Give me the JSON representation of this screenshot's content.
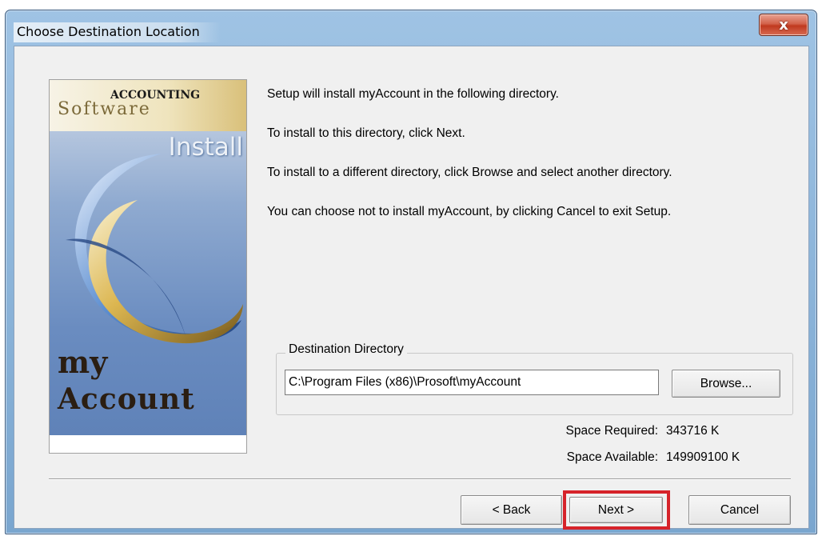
{
  "window": {
    "title": "Choose Destination Location",
    "close_label": "x"
  },
  "banner": {
    "accounting": "ACCOUNTING",
    "software": "Software",
    "install": "Install",
    "my": "my",
    "account": "Account"
  },
  "info": {
    "line1": "Setup will install myAccount in the following directory.",
    "line2": "To install to this directory, click Next.",
    "line3": "To install to a different directory, click Browse and select another directory.",
    "line4": "You can choose not to install myAccount, by clicking Cancel to exit Setup."
  },
  "destination": {
    "legend": "Destination Directory",
    "path": "C:\\Program Files (x86)\\Prosoft\\myAccount",
    "browse_label": "Browse..."
  },
  "space": {
    "required_label": "Space Required:",
    "required_value": "343716 K",
    "available_label": "Space Available:",
    "available_value": "149909100 K"
  },
  "buttons": {
    "back": "< Back",
    "next": "Next >",
    "cancel": "Cancel"
  },
  "colors": {
    "highlight": "#d6232a"
  }
}
